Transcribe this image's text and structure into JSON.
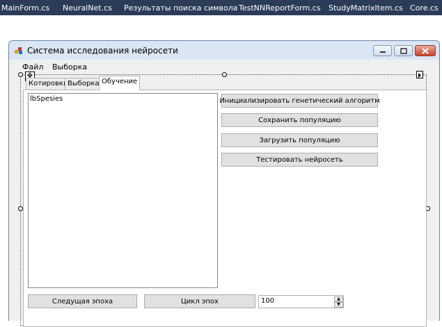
{
  "doc_tabs": [
    "MainForm.cs",
    "NeuralNet.cs",
    "Результаты поиска символа",
    "TestNNReportForm.cs",
    "StudyMatrixItem.cs",
    "Core.cs"
  ],
  "window": {
    "title": "Система исследования нейросети",
    "icon": "app-icon",
    "controls": [
      "minimize-icon",
      "maximize-icon",
      "close-icon"
    ]
  },
  "menu": [
    "Файл",
    "Выборка"
  ],
  "tabs": [
    "Котировки",
    "Выборка",
    "Обучение"
  ],
  "active_tab": "Обучение",
  "listbox": {
    "item": "lbSpesies"
  },
  "buttons": {
    "init_ga": "Инициализировать генетический алгоритм",
    "save_population": "Сохранить популяцию",
    "load_population": "Загрузить популяцию",
    "test_network": "Тестировать нейросеть",
    "next_epoch": "Следущая эпоха",
    "epoch_cycle": "Цикл эпох"
  },
  "epoch_count": "100",
  "colors": {
    "tab_strip": "#2b3c59",
    "close_button": "#c8452c"
  }
}
